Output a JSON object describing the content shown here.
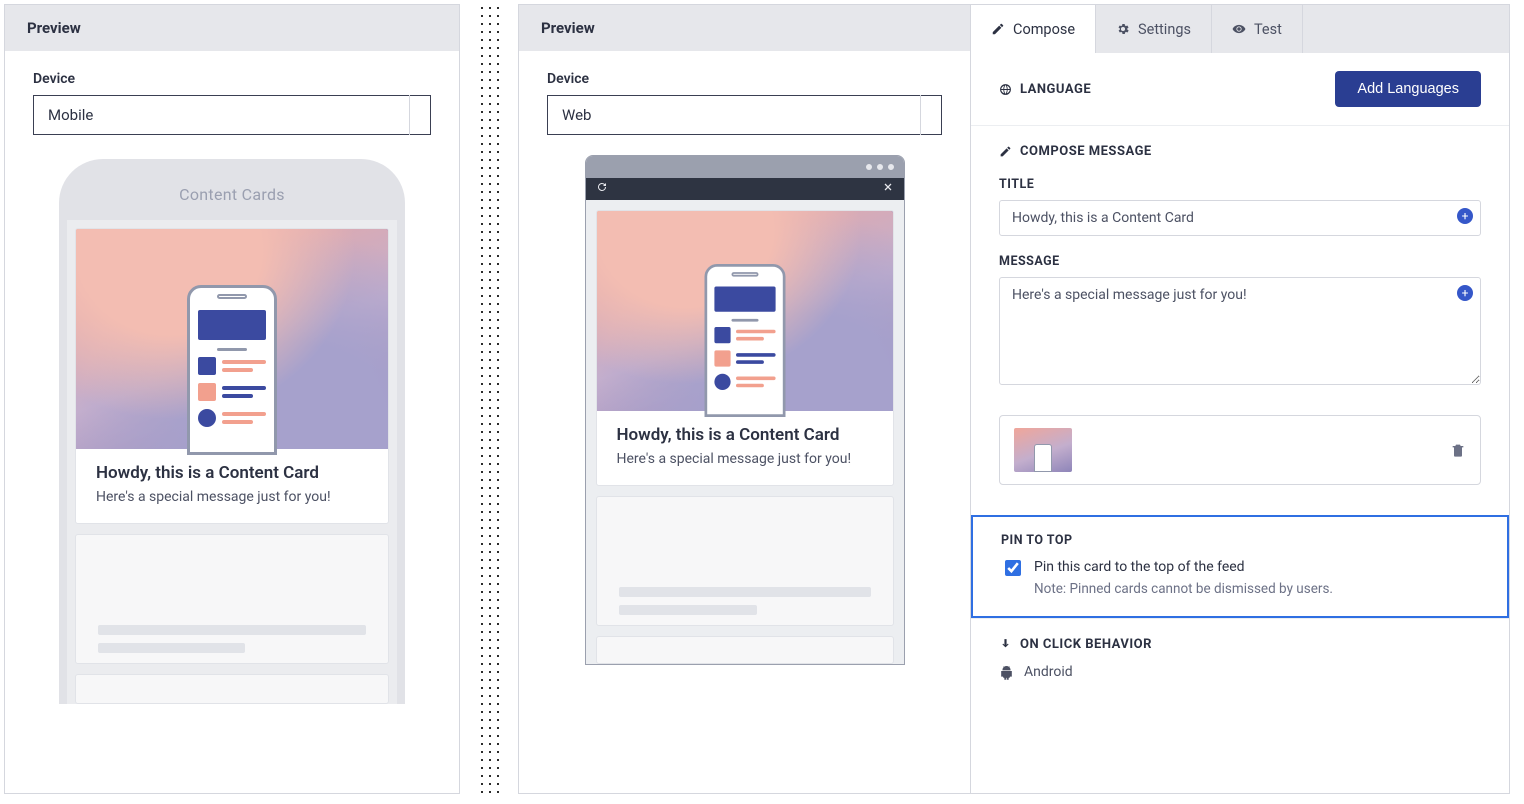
{
  "mobile_panel": {
    "header": "Preview",
    "device_label": "Device",
    "device_value": "Mobile",
    "frame_title": "Content Cards"
  },
  "web_panel": {
    "header": "Preview",
    "device_label": "Device",
    "device_value": "Web"
  },
  "card": {
    "title": "Howdy, this is a Content Card",
    "message": "Here's a special message just for you!"
  },
  "editor": {
    "tabs": {
      "compose": "Compose",
      "settings": "Settings",
      "test": "Test"
    },
    "language_head": "LANGUAGE",
    "add_languages": "Add Languages",
    "compose_head": "COMPOSE MESSAGE",
    "title_label": "TITLE",
    "title_value": "Howdy, this is a Content Card",
    "message_label": "MESSAGE",
    "message_value": "Here's a special message just for you!",
    "pin": {
      "head": "PIN TO TOP",
      "label": "Pin this card to the top of the feed",
      "note": "Note: Pinned cards cannot be dismissed by users."
    },
    "onclick_head": "ON CLICK BEHAVIOR",
    "platforms": {
      "android": "Android"
    }
  }
}
